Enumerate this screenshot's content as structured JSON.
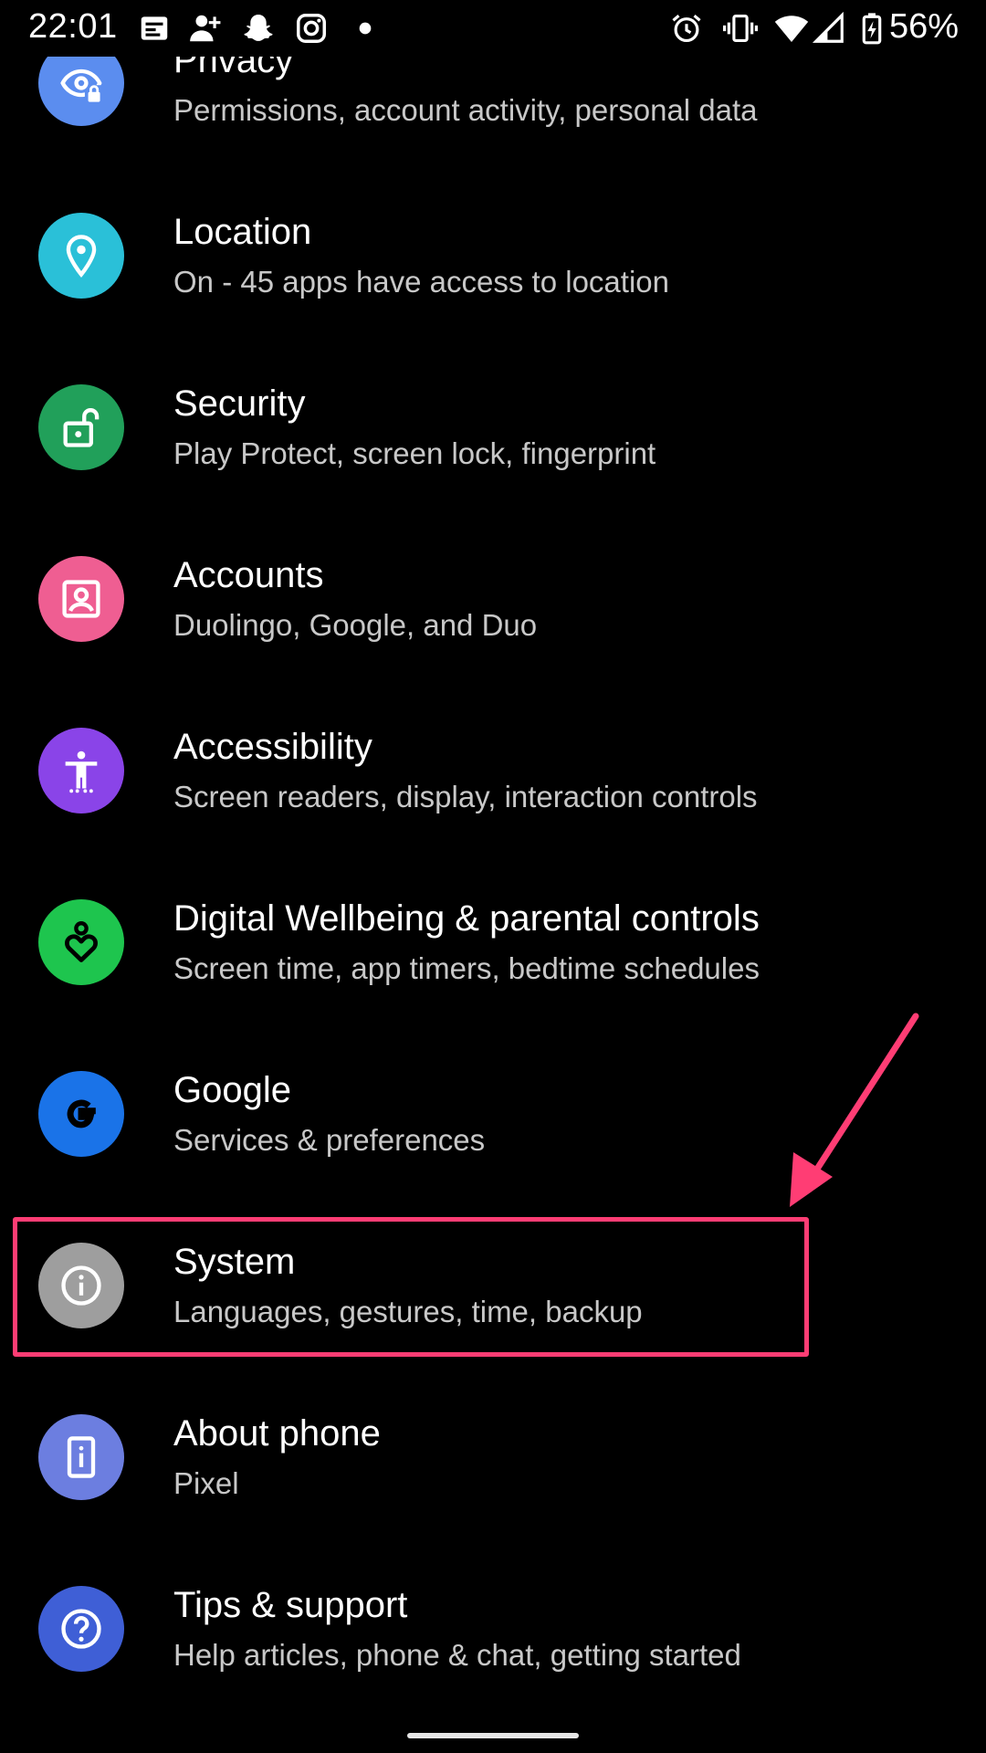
{
  "status_bar": {
    "time": "22:01",
    "battery": "56%",
    "left_icons": [
      "news-icon",
      "add-contact-icon",
      "snapchat-icon",
      "instagram-icon",
      "dot-icon"
    ],
    "right_icons": [
      "alarm-icon",
      "vibrate-icon",
      "wifi-icon",
      "signal-icon",
      "battery-charging-icon"
    ]
  },
  "settings": [
    {
      "id": "privacy",
      "title": "Privacy",
      "subtitle": "Permissions, account activity, personal data",
      "icon": "privacy-eye-icon",
      "color": "#5b8def"
    },
    {
      "id": "location",
      "title": "Location",
      "subtitle": "On - 45 apps have access to location",
      "icon": "location-pin-icon",
      "color": "#2ac0d8"
    },
    {
      "id": "security",
      "title": "Security",
      "subtitle": "Play Protect, screen lock, fingerprint",
      "icon": "unlock-icon",
      "color": "#21a05a"
    },
    {
      "id": "accounts",
      "title": "Accounts",
      "subtitle": "Duolingo, Google, and Duo",
      "icon": "account-box-icon",
      "color": "#ef5e92"
    },
    {
      "id": "accessibility",
      "title": "Accessibility",
      "subtitle": "Screen readers, display, interaction controls",
      "icon": "accessibility-icon",
      "color": "#8a44e8"
    },
    {
      "id": "wellbeing",
      "title": "Digital Wellbeing & parental controls",
      "subtitle": "Screen time, app timers, bedtime schedules",
      "icon": "wellbeing-heart-icon",
      "color": "#1ec54e"
    },
    {
      "id": "google",
      "title": "Google",
      "subtitle": "Services & preferences",
      "icon": "google-g-icon",
      "color": "#1a73e8"
    },
    {
      "id": "system",
      "title": "System",
      "subtitle": "Languages, gestures, time, backup",
      "icon": "info-icon",
      "color": "#9e9e9e"
    },
    {
      "id": "about",
      "title": "About phone",
      "subtitle": "Pixel",
      "icon": "phone-info-icon",
      "color": "#6c7ee0"
    },
    {
      "id": "tips",
      "title": "Tips & support",
      "subtitle": "Help articles, phone & chat, getting started",
      "icon": "help-icon",
      "color": "#3f5fd6"
    }
  ],
  "annotation": {
    "highlight_color": "#ff3d74",
    "highlighted_item": "system"
  }
}
